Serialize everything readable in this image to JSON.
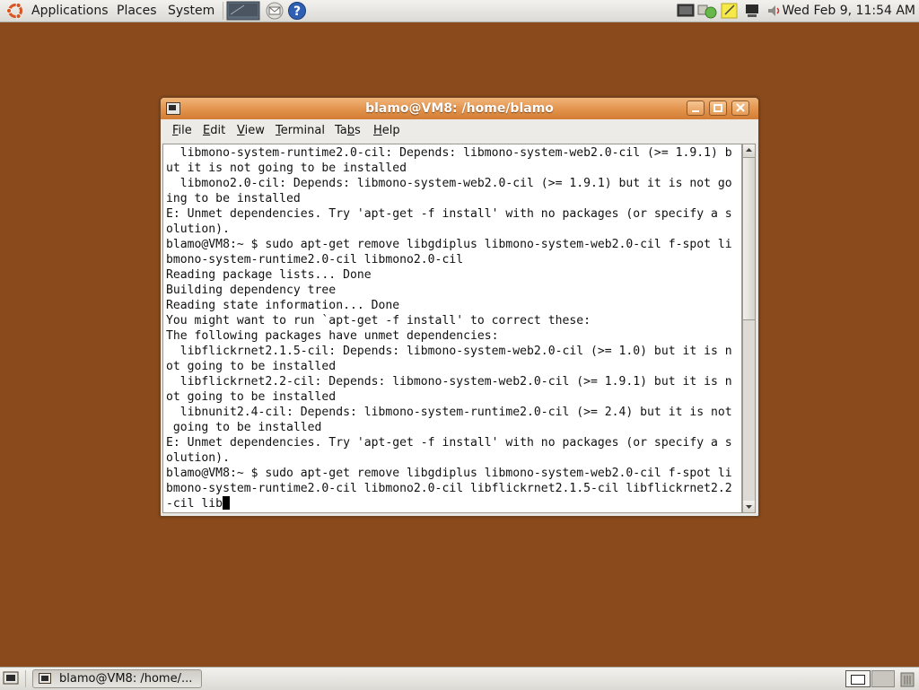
{
  "top_panel": {
    "menus": [
      "Applications",
      "Places",
      "System"
    ],
    "clock": "Wed Feb  9, 11:54 AM"
  },
  "window": {
    "title": "blamo@VM8: /home/blamo",
    "menu": [
      {
        "pre": "",
        "u": "F",
        "post": "ile"
      },
      {
        "pre": "",
        "u": "E",
        "post": "dit"
      },
      {
        "pre": "",
        "u": "V",
        "post": "iew"
      },
      {
        "pre": "",
        "u": "T",
        "post": "erminal"
      },
      {
        "pre": "Ta",
        "u": "b",
        "post": "s"
      },
      {
        "pre": "",
        "u": "H",
        "post": "elp"
      }
    ],
    "terminal_lines": [
      "  libmono-system-runtime2.0-cil: Depends: libmono-system-web2.0-cil (>= 1.9.1) b",
      "ut it is not going to be installed",
      "  libmono2.0-cil: Depends: libmono-system-web2.0-cil (>= 1.9.1) but it is not go",
      "ing to be installed",
      "E: Unmet dependencies. Try 'apt-get -f install' with no packages (or specify a s",
      "olution).",
      "blamo@VM8:~ $ sudo apt-get remove libgdiplus libmono-system-web2.0-cil f-spot li",
      "bmono-system-runtime2.0-cil libmono2.0-cil",
      "Reading package lists... Done",
      "Building dependency tree",
      "Reading state information... Done",
      "You might want to run `apt-get -f install' to correct these:",
      "The following packages have unmet dependencies:",
      "  libflickrnet2.1.5-cil: Depends: libmono-system-web2.0-cil (>= 1.0) but it is n",
      "ot going to be installed",
      "  libflickrnet2.2-cil: Depends: libmono-system-web2.0-cil (>= 1.9.1) but it is n",
      "ot going to be installed",
      "  libnunit2.4-cil: Depends: libmono-system-runtime2.0-cil (>= 2.4) but it is not",
      " going to be installed",
      "E: Unmet dependencies. Try 'apt-get -f install' with no packages (or specify a s",
      "olution).",
      "blamo@VM8:~ $ sudo apt-get remove libgdiplus libmono-system-web2.0-cil f-spot li",
      "bmono-system-runtime2.0-cil libmono2.0-cil libflickrnet2.1.5-cil libflickrnet2.2",
      "-cil lib"
    ]
  },
  "taskbar": {
    "task_label": "blamo@VM8: /home/..."
  },
  "icons": {
    "ubuntu": "ubuntu-logo-icon",
    "terminal_launcher": "terminal-launcher-icon",
    "mail_launcher": "mail-launcher-icon",
    "help_launcher": "help-icon",
    "show_desktop": "show-desktop-icon"
  },
  "colors": {
    "desktop": "#8a4a1c",
    "titlebar": "#e2924b",
    "panel": "#e6e4df"
  }
}
